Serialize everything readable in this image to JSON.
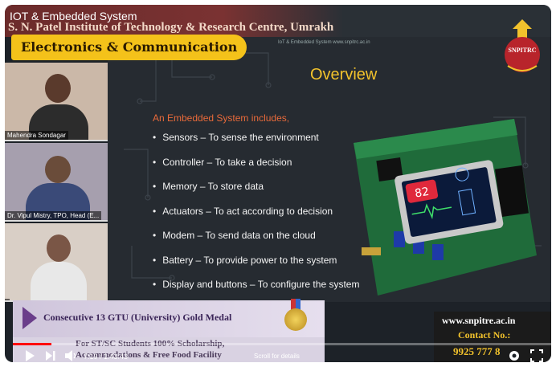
{
  "video": {
    "overlay_title": "IOT & Embedded System",
    "institute": "S. N. Patel Institute of Technology & Research Centre, Umrakh",
    "department_badge": "Electronics & Communication",
    "slide_tiny_url": "IoT & Embedded System www.snpitrc.ac.in",
    "logo_text": "SNPITRC"
  },
  "participants": [
    {
      "name": "Mahendra Sondagar"
    },
    {
      "name": "Dr. Vipul Mistry, TPO, Head (E..."
    },
    {
      "name": ""
    }
  ],
  "slide": {
    "title": "Overview",
    "intro": "An Embedded System includes,",
    "bullets": [
      "Sensors – To sense the environment",
      "Controller – To take a decision",
      "Memory – To store data",
      "Actuators – To act according to decision",
      "Modem – To send data on the cloud",
      "Battery – To provide power to the system",
      "Display and buttons – To configure the system"
    ],
    "screen_reading": "82"
  },
  "banners": {
    "gold_medal": "Consecutive 13 GTU (University) Gold Medal",
    "scholarship_line1": "For ST/SC Students 100% Scholarship,",
    "scholarship_line2": "Accommodations & Free Food Facility",
    "website": "www.snpitre.ac.in",
    "contact_label": "Contact No.:",
    "phone": "9925 777 8"
  },
  "player": {
    "time": "7:19 / 1:43:43",
    "progress_fraction": 0.071,
    "scroll_hint": "Scroll for details",
    "icons": [
      "play-icon",
      "next-icon",
      "volume-icon",
      "settings-icon",
      "fullscreen-icon"
    ]
  },
  "colors": {
    "slide_title": "#f2c22c",
    "intro": "#e96a3a",
    "badge": "#f4c21a",
    "progress": "#ff0000"
  }
}
